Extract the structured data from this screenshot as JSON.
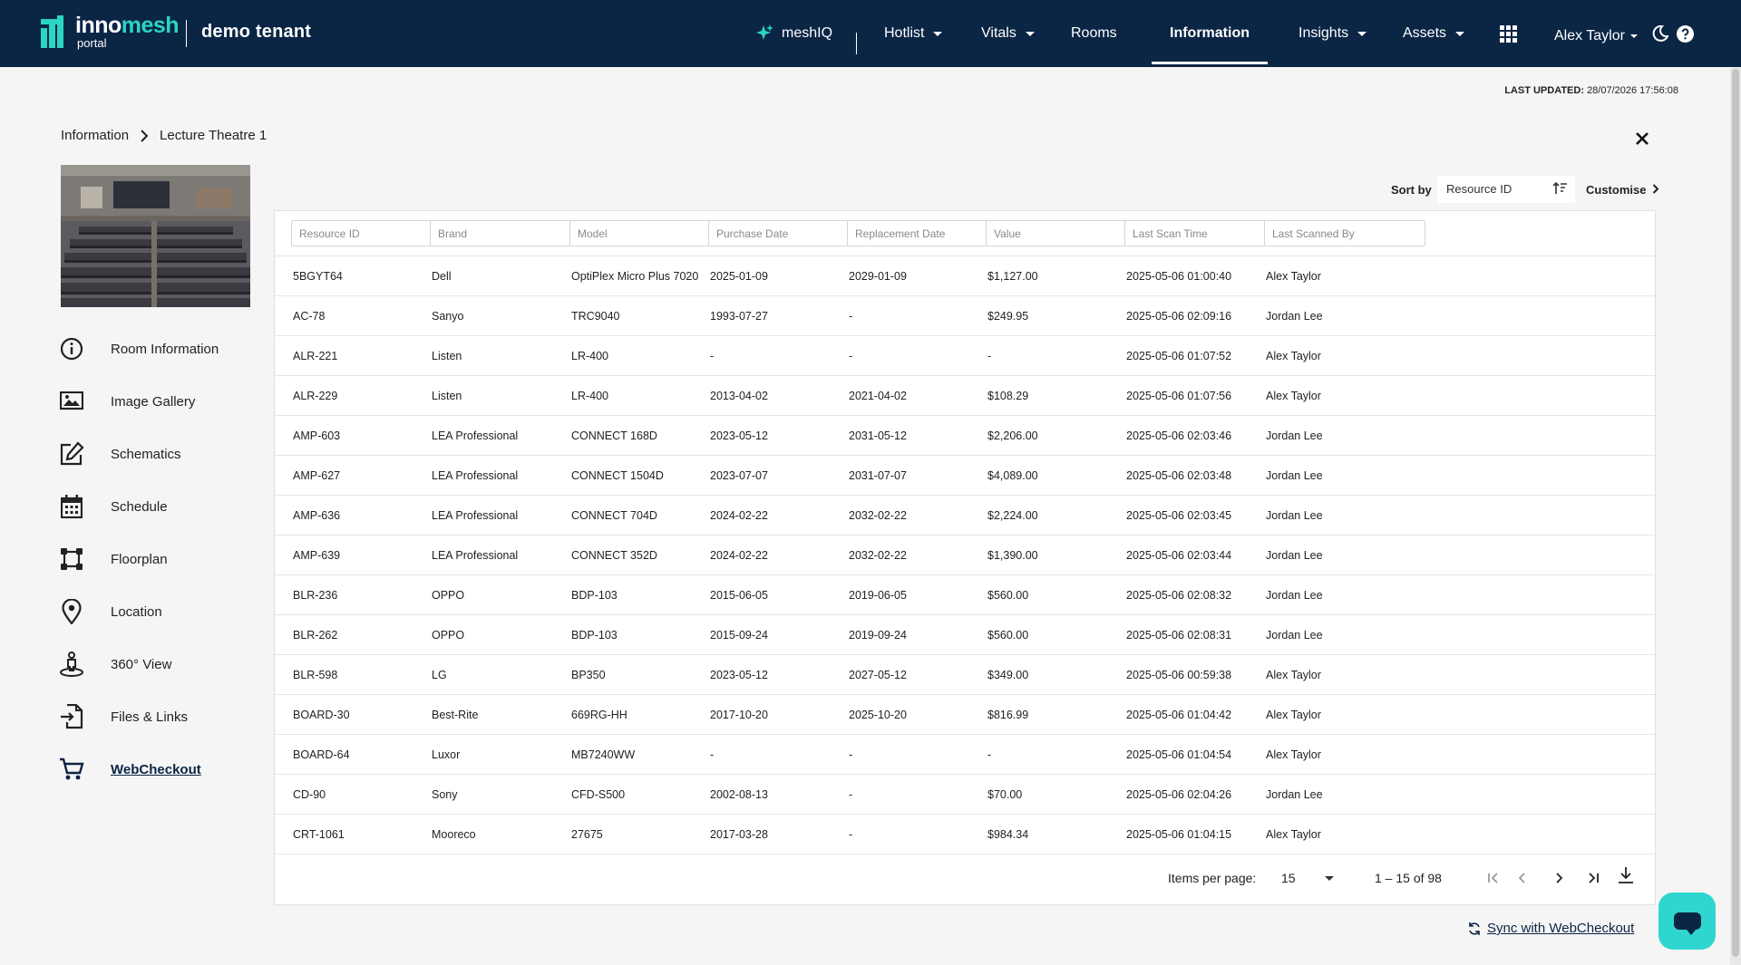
{
  "header": {
    "logo_main": "inno",
    "logo_accent": "mesh",
    "logo_sub": "portal",
    "tenant": "demo tenant",
    "nav": [
      {
        "label": "meshIQ",
        "caret": false,
        "active": false
      },
      {
        "label": "Hotlist",
        "caret": true,
        "active": false
      },
      {
        "label": "Vitals",
        "caret": true,
        "active": false
      },
      {
        "label": "Rooms",
        "caret": false,
        "active": false
      },
      {
        "label": "Information",
        "caret": false,
        "active": true
      },
      {
        "label": "Insights",
        "caret": true,
        "active": false
      },
      {
        "label": "Assets",
        "caret": true,
        "active": false
      }
    ],
    "user": "Alex Taylor",
    "accent_color": "#2bd4c4",
    "bar_color": "#0b2545"
  },
  "last_updated": {
    "label": "LAST UPDATED:",
    "value": "28/07/2026 17:56:08"
  },
  "breadcrumb": {
    "root": "Information",
    "current": "Lecture Theatre 1"
  },
  "side_menu": [
    {
      "label": "Room Information",
      "icon": "info-icon",
      "active": false
    },
    {
      "label": "Image Gallery",
      "icon": "image-icon",
      "active": false
    },
    {
      "label": "Schematics",
      "icon": "edit-icon",
      "active": false
    },
    {
      "label": "Schedule",
      "icon": "calendar-icon",
      "active": false
    },
    {
      "label": "Floorplan",
      "icon": "floorplan-icon",
      "active": false
    },
    {
      "label": "Location",
      "icon": "location-pin-icon",
      "active": false
    },
    {
      "label": "360° View",
      "icon": "street-view-icon",
      "active": false
    },
    {
      "label": "Files & Links",
      "icon": "file-link-icon",
      "active": false
    },
    {
      "label": "WebCheckout",
      "icon": "cart-icon",
      "active": true
    }
  ],
  "sort": {
    "label": "Sort by",
    "value": "Resource ID",
    "customise": "Customise"
  },
  "table": {
    "filters": [
      "Resource ID",
      "Brand",
      "Model",
      "Purchase Date",
      "Replacement Date",
      "Value",
      "Last Scan Time",
      "Last Scanned By"
    ],
    "rows": [
      [
        "5BGYT64",
        "Dell",
        "OptiPlex Micro Plus 7020",
        "2025-01-09",
        "2029-01-09",
        "$1,127.00",
        "2025-05-06 01:00:40",
        "Alex Taylor"
      ],
      [
        "AC-78",
        "Sanyo",
        "TRC9040",
        "1993-07-27",
        "-",
        "$249.95",
        "2025-05-06 02:09:16",
        "Jordan Lee"
      ],
      [
        "ALR-221",
        "Listen",
        "LR-400",
        "-",
        "-",
        "-",
        "2025-05-06 01:07:52",
        "Alex Taylor"
      ],
      [
        "ALR-229",
        "Listen",
        "LR-400",
        "2013-04-02",
        "2021-04-02",
        "$108.29",
        "2025-05-06 01:07:56",
        "Alex Taylor"
      ],
      [
        "AMP-603",
        "LEA Professional",
        "CONNECT 168D",
        "2023-05-12",
        "2031-05-12",
        "$2,206.00",
        "2025-05-06 02:03:46",
        "Jordan Lee"
      ],
      [
        "AMP-627",
        "LEA Professional",
        "CONNECT 1504D",
        "2023-07-07",
        "2031-07-07",
        "$4,089.00",
        "2025-05-06 02:03:48",
        "Jordan Lee"
      ],
      [
        "AMP-636",
        "LEA Professional",
        "CONNECT 704D",
        "2024-02-22",
        "2032-02-22",
        "$2,224.00",
        "2025-05-06 02:03:45",
        "Jordan Lee"
      ],
      [
        "AMP-639",
        "LEA Professional",
        "CONNECT 352D",
        "2024-02-22",
        "2032-02-22",
        "$1,390.00",
        "2025-05-06 02:03:44",
        "Jordan Lee"
      ],
      [
        "BLR-236",
        "OPPO",
        "BDP-103",
        "2015-06-05",
        "2019-06-05",
        "$560.00",
        "2025-05-06 02:08:32",
        "Jordan Lee"
      ],
      [
        "BLR-262",
        "OPPO",
        "BDP-103",
        "2015-09-24",
        "2019-09-24",
        "$560.00",
        "2025-05-06 02:08:31",
        "Jordan Lee"
      ],
      [
        "BLR-598",
        "LG",
        "BP350",
        "2023-05-12",
        "2027-05-12",
        "$349.00",
        "2025-05-06 00:59:38",
        "Alex Taylor"
      ],
      [
        "BOARD-30",
        "Best-Rite",
        "669RG-HH",
        "2017-10-20",
        "2025-10-20",
        "$816.99",
        "2025-05-06 01:04:42",
        "Alex Taylor"
      ],
      [
        "BOARD-64",
        "Luxor",
        "MB7240WW",
        "-",
        "-",
        "-",
        "2025-05-06 01:04:54",
        "Alex Taylor"
      ],
      [
        "CD-90",
        "Sony",
        "CFD-S500",
        "2002-08-13",
        "-",
        "$70.00",
        "2025-05-06 02:04:26",
        "Jordan Lee"
      ],
      [
        "CRT-1061",
        "Mooreco",
        "27675",
        "2017-03-28",
        "-",
        "$984.34",
        "2025-05-06 01:04:15",
        "Alex Taylor"
      ]
    ]
  },
  "paginator": {
    "items_label": "Items per page:",
    "page_size": "15",
    "range": "1 – 15 of 98"
  },
  "sync": {
    "label": "Sync with WebCheckout"
  }
}
